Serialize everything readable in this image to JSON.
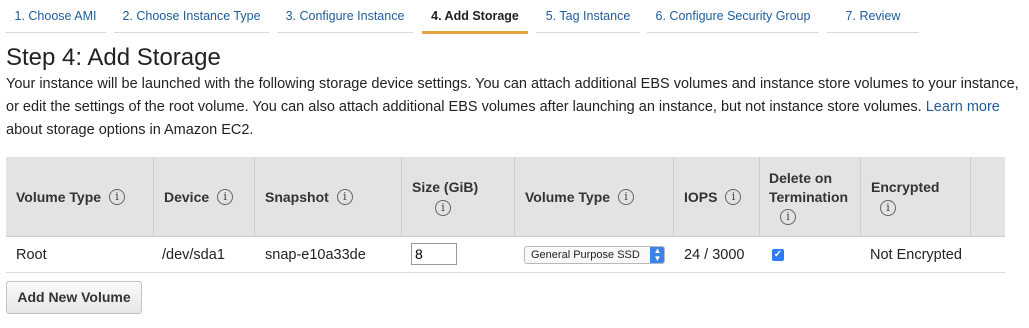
{
  "wizard": {
    "steps": [
      {
        "label": "1. Choose AMI"
      },
      {
        "label": "2. Choose Instance Type"
      },
      {
        "label": "3. Configure Instance"
      },
      {
        "label": "4. Add Storage"
      },
      {
        "label": "5. Tag Instance"
      },
      {
        "label": "6. Configure Security Group"
      },
      {
        "label": "7. Review"
      }
    ],
    "active_index": 3
  },
  "page": {
    "title": "Step 4: Add Storage",
    "description_before_link": "Your instance will be launched with the following storage device settings. You can attach additional EBS volumes and instance store volumes to your instance, or edit the settings of the root volume. You can also attach additional EBS volumes after launching an instance, but not instance store volumes.",
    "learn_more_link": "Learn more",
    "description_after_link": "about storage options in Amazon EC2."
  },
  "table": {
    "headers": {
      "volume_type": "Volume Type",
      "device": "Device",
      "snapshot": "Snapshot",
      "size_line1": "Size (GiB)",
      "volume_type2": "Volume Type",
      "iops": "IOPS",
      "delete_line1": "Delete on",
      "delete_line2": "Termination",
      "encrypted": "Encrypted"
    },
    "info_glyph": "i",
    "rows": [
      {
        "volume_type": "Root",
        "device": "/dev/sda1",
        "snapshot": "snap-e10a33de",
        "size": "8",
        "ebs_type": "General Purpose SSD",
        "iops": "24 / 3000",
        "delete_on_termination": true,
        "encrypted": "Not Encrypted"
      }
    ]
  },
  "buttons": {
    "add_new_volume": "Add New Volume"
  },
  "colors": {
    "link": "#1f5c99",
    "active_tab_underline": "#e8a33d",
    "header_bg": "#e3e3e3",
    "checkbox": "#2e7cf6"
  }
}
